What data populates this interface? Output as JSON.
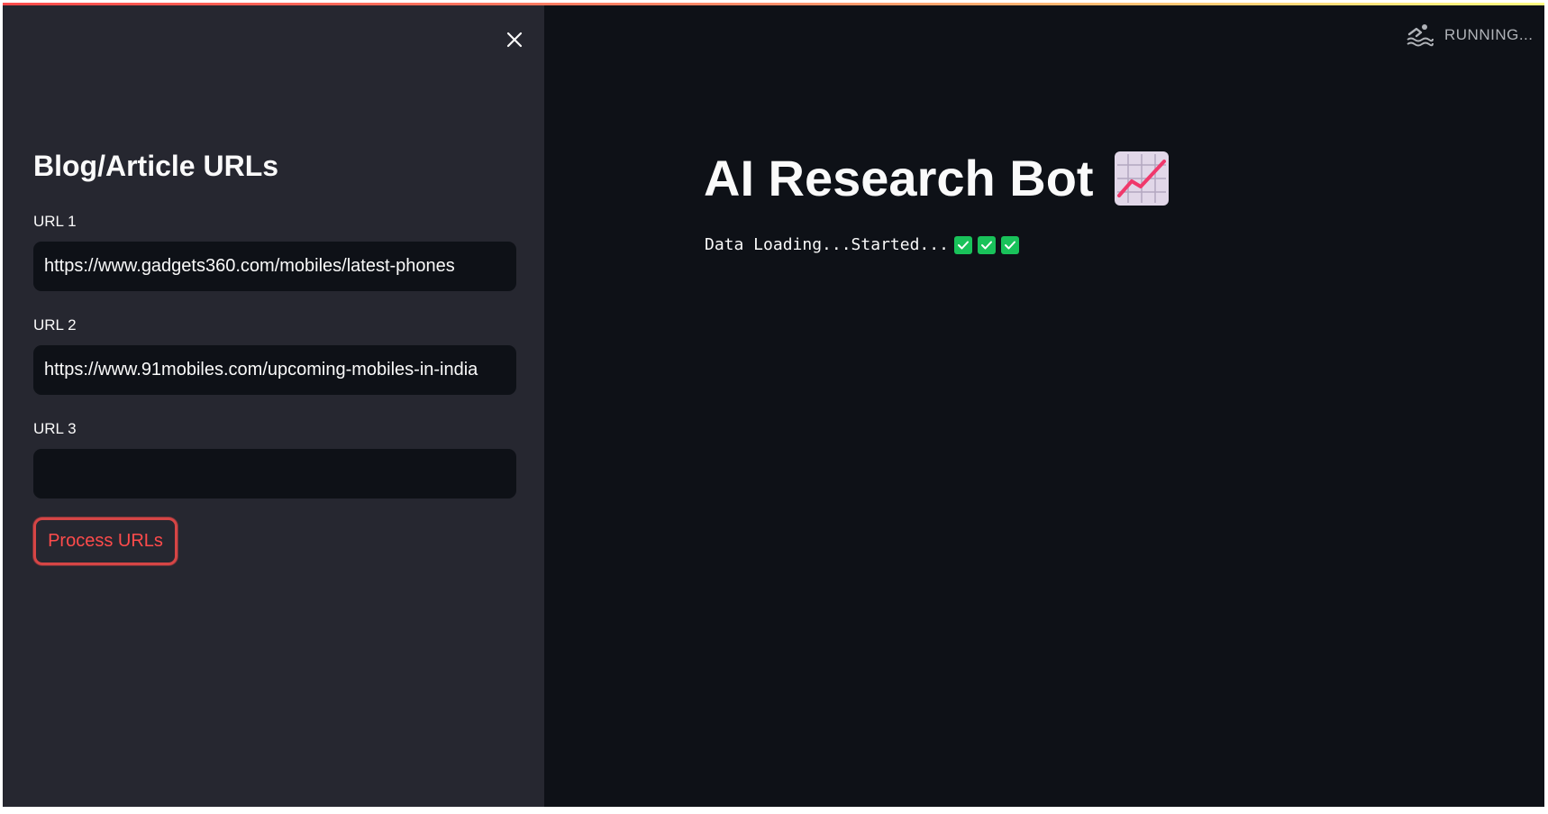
{
  "app": {
    "status": "RUNNING...",
    "status_icon": "swimmer-icon",
    "accent_color": "#ff4b4b"
  },
  "sidebar": {
    "close_icon": "close-icon",
    "title": "Blog/Article URLs",
    "fields": [
      {
        "label": "URL 1",
        "value": "https://www.gadgets360.com/mobiles/latest-phones",
        "placeholder": ""
      },
      {
        "label": "URL 2",
        "value": "https://www.91mobiles.com/upcoming-mobiles-in-india",
        "placeholder": ""
      },
      {
        "label": "URL 3",
        "value": "",
        "placeholder": ""
      }
    ],
    "process_button": "Process URLs"
  },
  "main": {
    "title": "AI Research Bot",
    "title_icon": "chart-increasing-icon",
    "loading_text": "Data Loading...Started...",
    "check_icons": [
      "check-mark-icon",
      "check-mark-icon",
      "check-mark-icon"
    ],
    "check_color": "#19c25a"
  }
}
